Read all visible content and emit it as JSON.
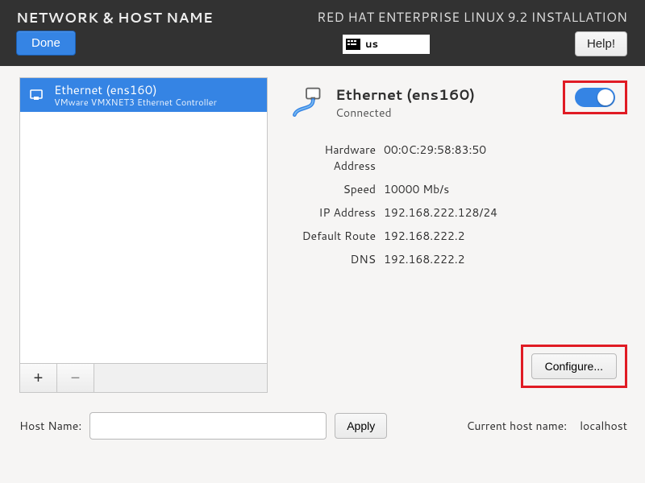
{
  "header": {
    "page_title": "NETWORK & HOST NAME",
    "product_title": "RED HAT ENTERPRISE LINUX 9.2 INSTALLATION",
    "done_label": "Done",
    "help_label": "Help!",
    "keyboard_layout": "us"
  },
  "interfaces": {
    "items": [
      {
        "name": "Ethernet (ens160)",
        "sub": "VMware VMXNET3 Ethernet Controller"
      }
    ]
  },
  "details": {
    "title": "Ethernet (ens160)",
    "status": "Connected",
    "enabled": true,
    "labels": {
      "hwaddr": "Hardware Address",
      "speed": "Speed",
      "ip": "IP Address",
      "route": "Default Route",
      "dns": "DNS"
    },
    "values": {
      "hwaddr": "00:0C:29:58:83:50",
      "speed": "10000 Mb/s",
      "ip": "192.168.222.128/24",
      "route": "192.168.222.2",
      "dns": "192.168.222.2"
    },
    "configure_label": "Configure..."
  },
  "host": {
    "label": "Host Name:",
    "value": "",
    "apply_label": "Apply",
    "current_label": "Current host name:",
    "current_value": "localhost"
  }
}
